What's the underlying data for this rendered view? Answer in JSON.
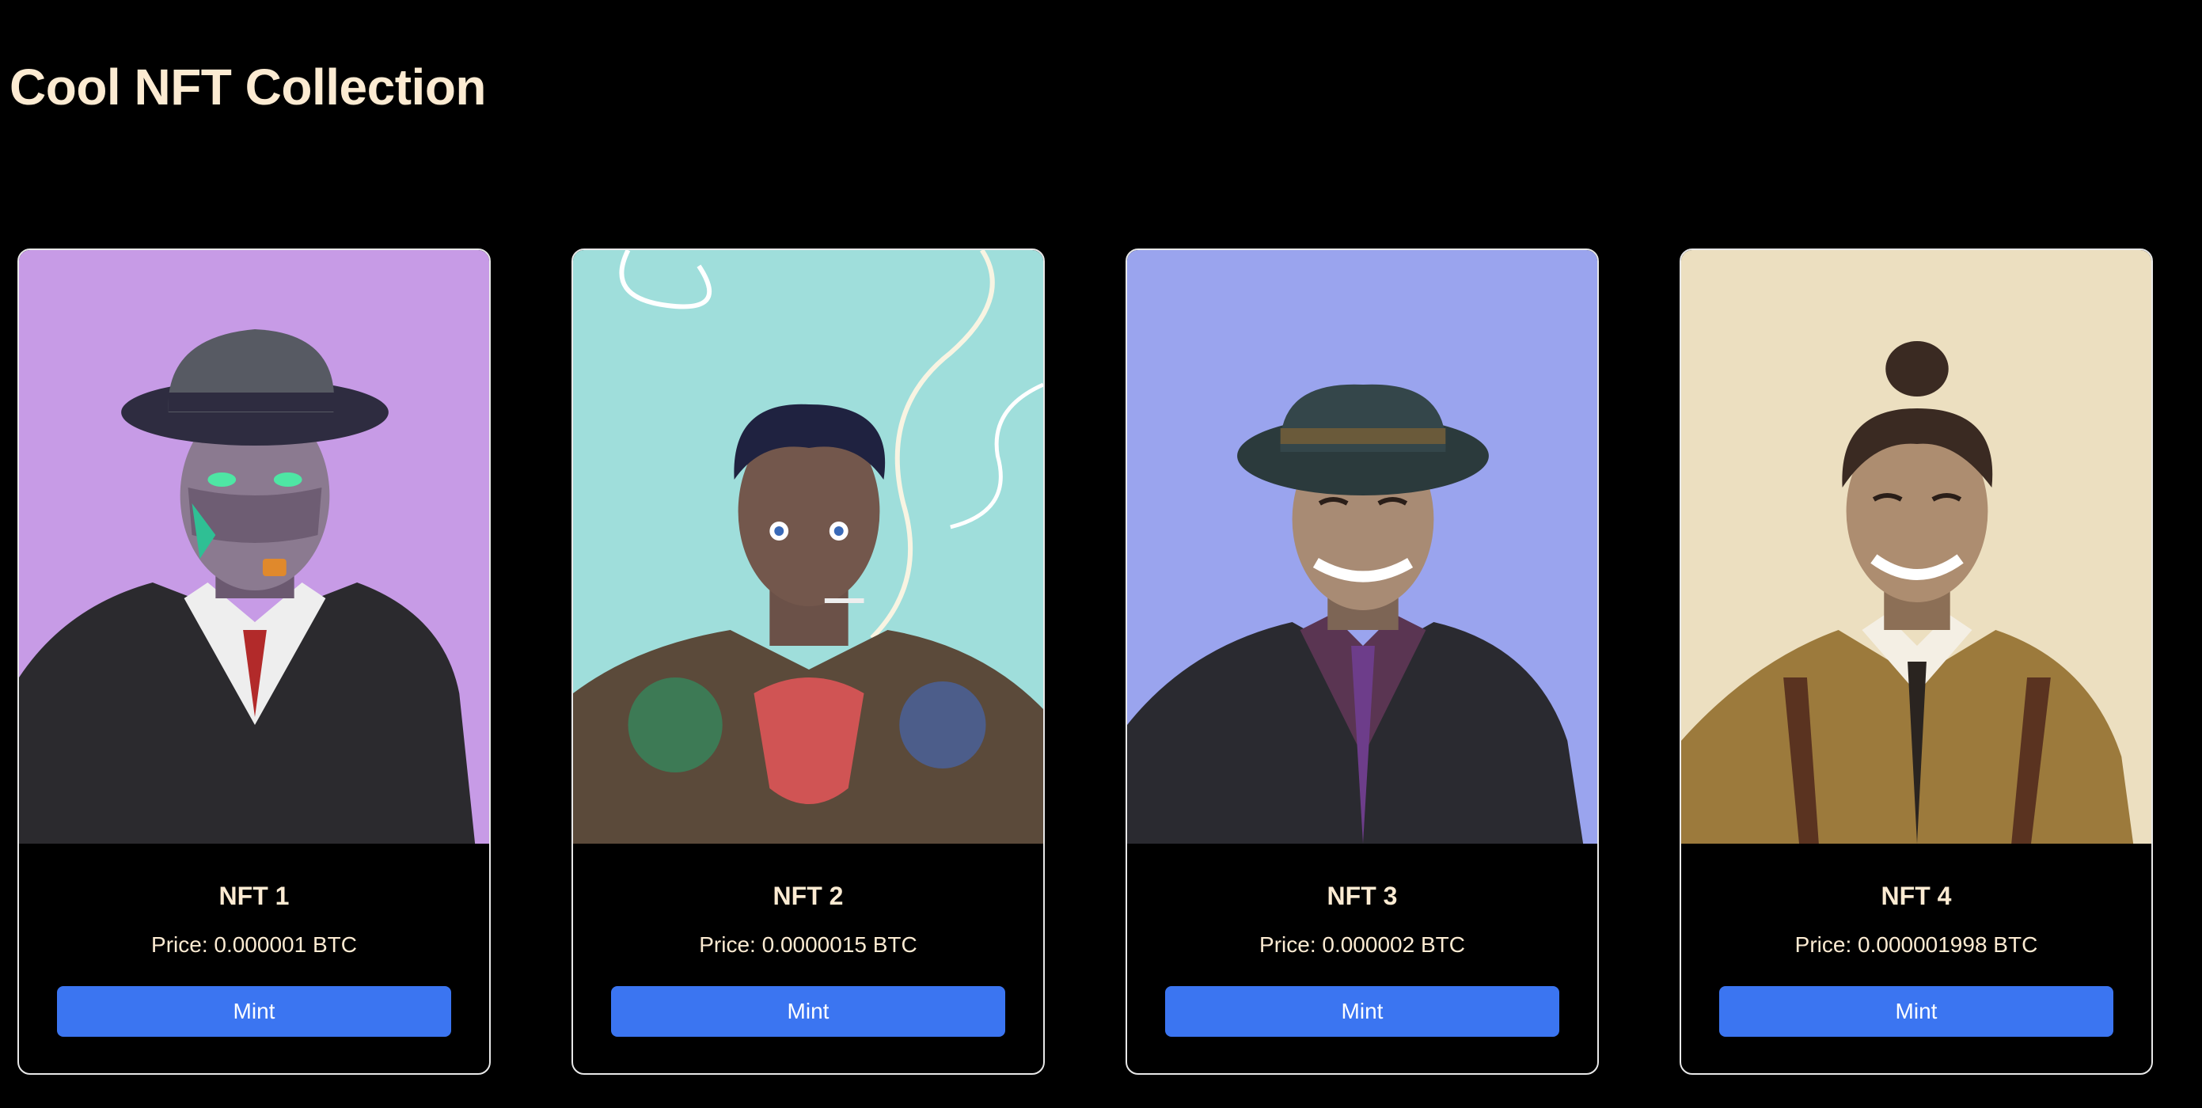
{
  "page": {
    "title": "Cool NFT Collection"
  },
  "colors": {
    "background": "#000000",
    "text": "#fcebd2",
    "button": "#3b75f1",
    "button_text": "#ffffff",
    "card_border": "#e8e8e8"
  },
  "nfts": [
    {
      "name": "NFT 1",
      "price": "Price: 0.000001 BTC",
      "button_label": "Mint",
      "art_background": "#c79be6",
      "art_description_icon": "cyborg-portrait-image"
    },
    {
      "name": "NFT 2",
      "price": "Price: 0.0000015 BTC",
      "button_label": "Mint",
      "art_background": "#9fdedb",
      "art_description_icon": "tattooed-smoker-portrait-image"
    },
    {
      "name": "NFT 3",
      "price": "Price: 0.000002 BTC",
      "button_label": "Mint",
      "art_background": "#9aa4ee",
      "art_description_icon": "fedora-gentleman-portrait-image"
    },
    {
      "name": "NFT 4",
      "price": "Price: 0.000001998 BTC",
      "button_label": "Mint",
      "art_background": "#ecdfc0",
      "art_description_icon": "topknot-suspenders-portrait-image"
    }
  ]
}
